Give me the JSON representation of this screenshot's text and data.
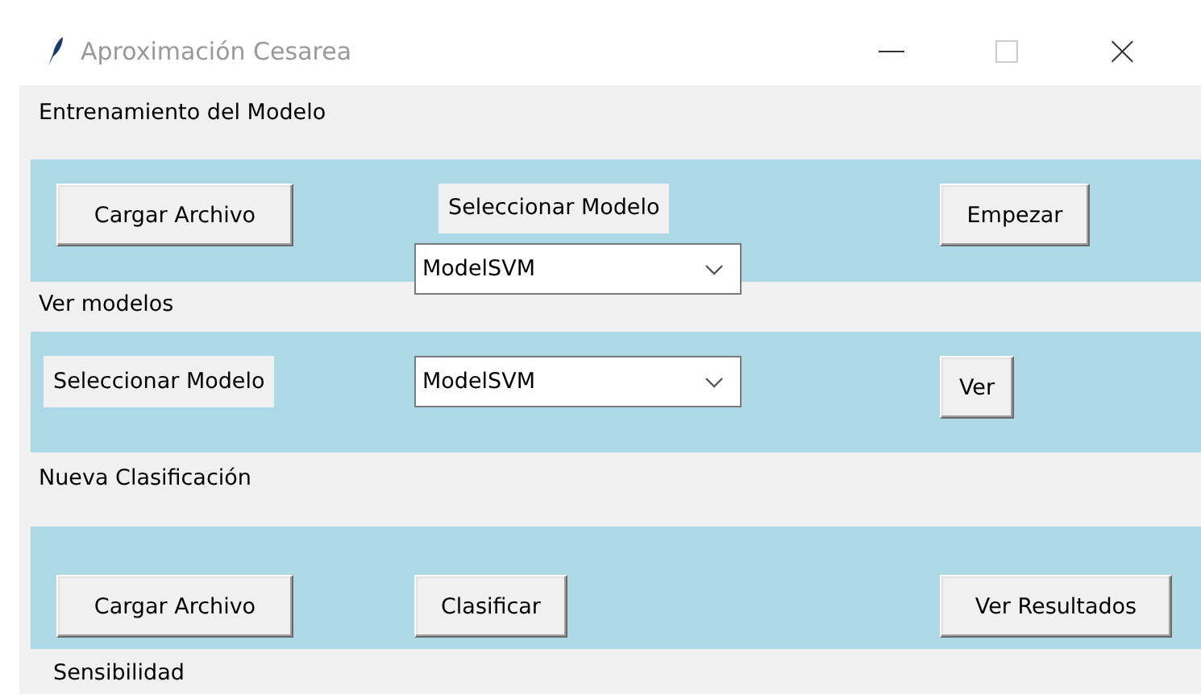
{
  "window": {
    "title": "Aproximación Cesarea"
  },
  "training": {
    "heading": "Entrenamiento del Modelo",
    "load_button": "Cargar Archivo",
    "model_label": "Seleccionar Modelo",
    "model_combo": "ModelSVM",
    "start_button": "Empezar"
  },
  "view": {
    "heading": "Ver modelos",
    "model_label": "Seleccionar Modelo",
    "model_combo": "ModelSVM",
    "view_button": "Ver"
  },
  "classify": {
    "heading": "Nueva Clasificación",
    "load_button": "Cargar Archivo",
    "classify_button": "Clasificar",
    "results_button": "Ver Resultados"
  },
  "footer": {
    "label": "Sensibilidad"
  }
}
